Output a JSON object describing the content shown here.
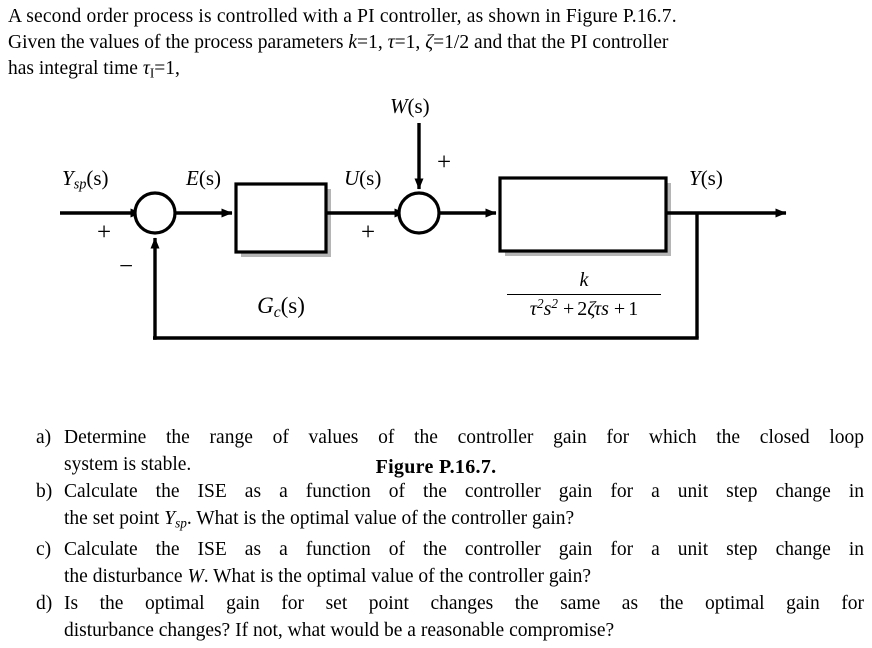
{
  "document": {
    "intro": {
      "line1": "A second order process is controlled with a PI controller, as shown in Figure P.16.7.",
      "line2_part1": "Given the values of the process parameters ",
      "line2_k": "k",
      "line2_eq1": "=1, ",
      "line2_tau": "τ",
      "line2_eq2": "=1, ",
      "line2_zeta": "ζ",
      "line2_eq3": "=1/2 and that the PI controller",
      "line3_part1": "has integral time ",
      "line3_tau": "τ",
      "line3_sub": "I",
      "line3_eq": "=1,"
    },
    "figure": {
      "caption": "Figure P.16.7.",
      "labels": {
        "setpoint": {
          "var": "Y",
          "sub": "sp",
          "arg": "(s)"
        },
        "error": {
          "var": "E",
          "arg": "(s)"
        },
        "control": {
          "var": "U",
          "arg": "(s)"
        },
        "disturbance": {
          "var": "W",
          "arg": "(s)"
        },
        "output": {
          "var": "Y",
          "arg": "(s)"
        },
        "controller_block": {
          "var": "G",
          "sub": "c",
          "arg": "(s)"
        }
      },
      "signs": {
        "summer1_plus": "+",
        "summer1_minus": "−",
        "summer2_plus_top": "+",
        "summer2_plus_left": "+"
      },
      "process_transfer_function": {
        "numerator": "k",
        "denominator_tau": "τ",
        "denominator_tau_exp": "2",
        "denominator_s": "s",
        "denominator_s_exp": "2",
        "denominator_plus1": "+",
        "denominator_two": "2",
        "denominator_zeta": "ζ",
        "denominator_tau2": "τ",
        "denominator_s2": "s",
        "denominator_plus2": "+",
        "denominator_one": "1"
      }
    },
    "questions": [
      {
        "marker": "a)",
        "line1": "Determine the range of values of the controller gain for which the closed loop",
        "line2": "system is stable."
      },
      {
        "marker": "b)",
        "line1": "Calculate the ISE as a function of the controller gain for a unit step change in",
        "line2_pre": "the set point ",
        "line2_var": "Y",
        "line2_sub": "sp",
        "line2_post": ". What is the optimal value of the controller gain?"
      },
      {
        "marker": "c)",
        "line1": "Calculate the ISE as a function of the controller gain for a unit step change in",
        "line2_pre": "the disturbance ",
        "line2_var": "W",
        "line2_post": ". What is the optimal value of the controller gain?"
      },
      {
        "marker": "d)",
        "line1": "Is the optimal gain for set point changes the same as the optimal gain for",
        "line2": "disturbance changes? If not, what would be a reasonable compromise?"
      }
    ],
    "colors": {
      "ink": "#000000",
      "paper": "#ffffff",
      "shadow": "#b0b0b0"
    }
  }
}
